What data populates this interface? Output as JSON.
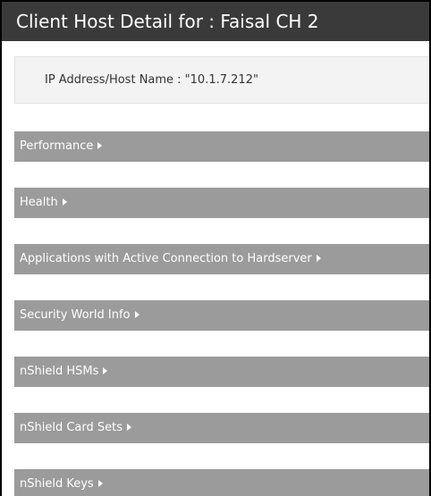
{
  "header": {
    "title": "Client Host Detail for : Faisal CH 2"
  },
  "info": {
    "ip_host": "IP Address/Host Name : \"10.1.7.212\""
  },
  "sections": [
    {
      "label": "Performance",
      "icon": "caret-right-icon"
    },
    {
      "label": "Health",
      "icon": "caret-right-icon"
    },
    {
      "label": "Applications with Active Connection to Hardserver",
      "icon": "caret-right-icon"
    },
    {
      "label": "Security World Info",
      "icon": "caret-right-icon"
    },
    {
      "label": "nShield HSMs",
      "icon": "caret-right-icon"
    },
    {
      "label": "nShield Card Sets",
      "icon": "caret-right-icon"
    },
    {
      "label": "nShield Keys",
      "icon": "caret-right-icon"
    }
  ],
  "colors": {
    "titlebar_bg": "#3a3a3a",
    "section_bg": "#9b9b9b",
    "info_bg": "#f3f3f3"
  }
}
